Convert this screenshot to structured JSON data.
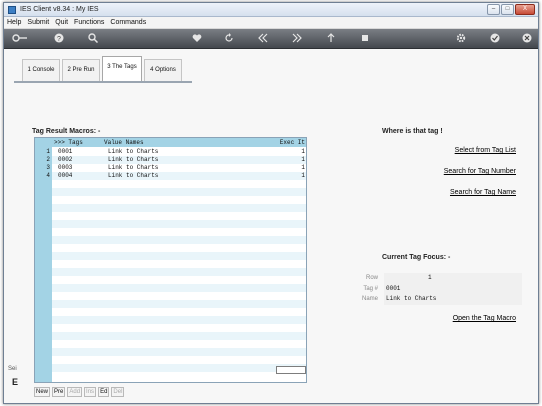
{
  "window": {
    "title": "IES Client v8.34 : My IES",
    "minimize": "–",
    "maximize": "□",
    "close": "X"
  },
  "menu": [
    "Help",
    "Submit",
    "Quit",
    "Functions",
    "Commands"
  ],
  "toolbar": {
    "icons": [
      "key-icon",
      "help-icon",
      "search-icon",
      "heart-icon",
      "refresh-icon",
      "rewind-icon",
      "forward-icon",
      "up-icon",
      "stop-icon",
      "gear-icon",
      "check-icon",
      "close-icon"
    ]
  },
  "tabs": [
    {
      "label": "1 Console"
    },
    {
      "label": "2 Pre Run"
    },
    {
      "label": "3 The Tags"
    },
    {
      "label": "4 Options"
    }
  ],
  "macros": {
    "title": "Tag Result Macros: -",
    "columns": {
      "tags": ">>> Tags",
      "value_names": "Value Names",
      "exec": "Exec It"
    },
    "rows": [
      {
        "n": "1",
        "tag": "0001",
        "value": "Link to Charts",
        "exec": "1"
      },
      {
        "n": "2",
        "tag": "0002",
        "value": "Link to Charts",
        "exec": "1"
      },
      {
        "n": "3",
        "tag": "0003",
        "value": "Link to Charts",
        "exec": "1"
      },
      {
        "n": "4",
        "tag": "0004",
        "value": "Link to Charts",
        "exec": "1"
      }
    ]
  },
  "bottom_buttons": [
    {
      "label": "New",
      "enabled": true
    },
    {
      "label": "Pre",
      "enabled": true
    },
    {
      "label": "Add",
      "enabled": false
    },
    {
      "label": "Ins",
      "enabled": false
    },
    {
      "label": "Ed",
      "enabled": true
    },
    {
      "label": "Del",
      "enabled": false
    }
  ],
  "left_stub": {
    "label": "Sei",
    "button": "E"
  },
  "where": {
    "title": "Where is that tag !",
    "links": [
      "Select from Tag List",
      "Search for Tag Number",
      "Search for Tag Name"
    ]
  },
  "focus": {
    "title": "Current Tag Focus: -",
    "row_label": "Row",
    "row_value": "1",
    "tag_label": "Tag #",
    "tag_value": "0001",
    "name_label": "Name",
    "name_value": "Link to Charts",
    "open_link": "Open the Tag Macro"
  },
  "colors": {
    "grid_header": "#a3d3e5",
    "stripe": "#e9f5fa",
    "toolbar": "#55595f"
  }
}
